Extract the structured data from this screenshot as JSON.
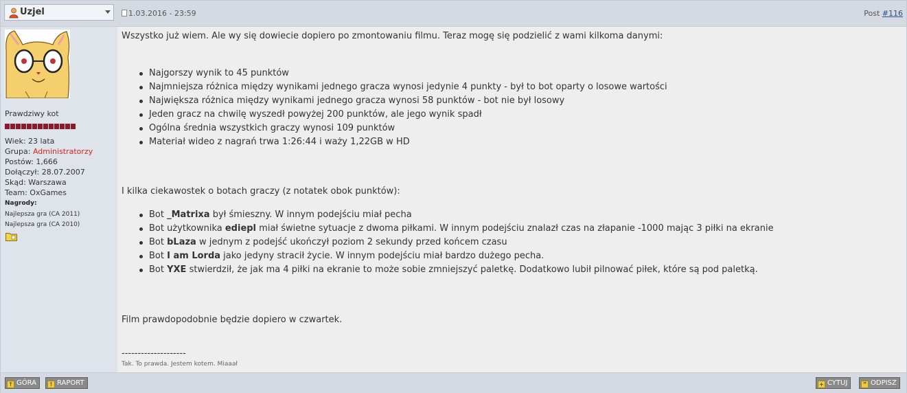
{
  "post": {
    "username": "Uzjel",
    "date": "1.03.2016 - 23:59",
    "post_prefix": "Post ",
    "post_number": "#116"
  },
  "sidebar": {
    "rank": "Prawdziwy kot",
    "rank_pips": 13,
    "info": [
      {
        "label": "Wiek: ",
        "value": "23 lata"
      },
      {
        "label": "Grupa: ",
        "value": "Administratorzy"
      },
      {
        "label": "Postów: ",
        "value": "1,666"
      },
      {
        "label": "Dołączył: ",
        "value": "28.07.2007"
      },
      {
        "label": "Skąd: ",
        "value": "Warszawa"
      },
      {
        "label": "Team: ",
        "value": "OxGames"
      }
    ],
    "awards_title": "Nagrody:",
    "awards": [
      "Najlepsza gra (CA 2011)",
      "Najlepsza gra (CA 2010)"
    ]
  },
  "content": {
    "intro": "Wszystko już wiem. Ale wy się dowiecie dopiero po zmontowaniu filmu. Teraz mogę się podzielić z wami kilkoma danymi:",
    "stats": [
      "Najgorszy wynik to 45 punktów",
      "Najmniejsza różnica między wynikami jednego gracza wynosi jedynie 4 punkty - był to bot oparty o losowe wartości",
      "Największa różnica między wynikami jednego gracza wynosi 58 punktów - bot nie był losowy",
      "Jeden gracz na chwilę wyszedł powyżej 200 punktów, ale jego wynik spadł",
      "Ogólna średnia wszystkich graczy wynosi 109 punktów",
      "Materiał wideo z nagrań trwa 1:26:44 i waży 1,22GB w HD"
    ],
    "curiosities_intro": "I kilka ciekawostek o botach graczy (z notatek obok punktów):",
    "bots": [
      {
        "pre": "Bot ",
        "name": "_Matrixa",
        "post": " był śmieszny. W innym podejściu miał pecha"
      },
      {
        "pre": "Bot użytkownika ",
        "name": "ediepl",
        "post": " miał świetne sytuacje z dwoma piłkami. W innym podejściu znalazł czas na złapanie -1000 mając 3 piłki na ekranie"
      },
      {
        "pre": "Bot ",
        "name": "bLaza",
        "post": " w jednym z podejść ukończył poziom 2 sekundy przed końcem czasu"
      },
      {
        "pre": "Bot ",
        "name": "I am Lorda",
        "post": " jako jedyny stracił życie. W innym podejściu miał bardzo dużego pecha."
      },
      {
        "pre": "Bot ",
        "name": "YXE",
        "post": " stwierdził, że jak ma 4 piłki na ekranie to może sobie zmniejszyć paletkę. Dodatkowo lubił pilnować piłek, które są pod paletką."
      }
    ],
    "closing": "Film prawdopodobnie będzie dopiero w czwartek.",
    "separator": "--------------------",
    "signature": "Tak. To prawda. Jestem kotem. Miaaał"
  },
  "footer": {
    "up": "GÓRA",
    "report": "RAPORT",
    "quote": "CYTUJ",
    "reply": "ODPISZ"
  },
  "colors": {
    "header_bg": "#d4d9e2",
    "sidebar_bg": "#dfe3ea",
    "content_bg": "#eeeeee",
    "group_color": "#d8261f",
    "pip_color": "#8a1b2d",
    "button_bg": "#8a8a8a"
  },
  "icons": [
    "user-icon",
    "dropdown-arrow-icon",
    "document-icon",
    "folder-icon",
    "arrow-up-icon",
    "warning-icon",
    "plus-icon",
    "quote-icon"
  ]
}
